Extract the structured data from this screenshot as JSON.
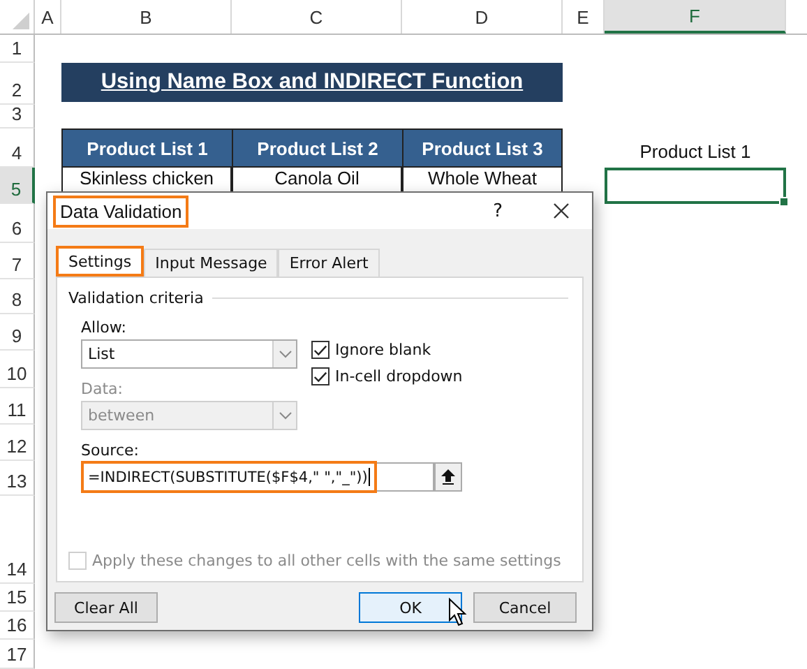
{
  "sheet": {
    "columns": [
      {
        "label": "A",
        "selected": false
      },
      {
        "label": "B",
        "selected": false
      },
      {
        "label": "C",
        "selected": false
      },
      {
        "label": "D",
        "selected": false
      },
      {
        "label": "E",
        "selected": false
      },
      {
        "label": "F",
        "selected": true
      }
    ],
    "rows": [
      {
        "label": "1",
        "selected": false
      },
      {
        "label": "2",
        "selected": false
      },
      {
        "label": "3",
        "selected": false
      },
      {
        "label": "4",
        "selected": false
      },
      {
        "label": "5",
        "selected": true
      },
      {
        "label": "6",
        "selected": false
      },
      {
        "label": "7",
        "selected": false
      },
      {
        "label": "8",
        "selected": false
      },
      {
        "label": "9",
        "selected": false
      },
      {
        "label": "10",
        "selected": false
      },
      {
        "label": "11",
        "selected": false
      },
      {
        "label": "12",
        "selected": false
      },
      {
        "label": "13",
        "selected": false
      },
      {
        "label": "14",
        "selected": false
      },
      {
        "label": "15",
        "selected": false
      },
      {
        "label": "16",
        "selected": false
      },
      {
        "label": "17",
        "selected": false
      }
    ],
    "title": "Using Name Box and INDIRECT Function",
    "table_headers": [
      "Product List 1",
      "Product List 2",
      "Product List 3"
    ],
    "table_row": [
      "Skinless chicken",
      "Canola Oil",
      "Whole Wheat"
    ],
    "f4_label": "Product List 1"
  },
  "dialog": {
    "title": "Data Validation",
    "title_highlighted": true,
    "help": "?",
    "tabs": [
      {
        "label": "Settings",
        "selected": true,
        "highlighted": true
      },
      {
        "label": "Input Message",
        "selected": false,
        "highlighted": false
      },
      {
        "label": "Error Alert",
        "selected": false,
        "highlighted": false
      }
    ],
    "section": "Validation criteria",
    "allow": {
      "label": "Allow:",
      "value": "List",
      "disabled": false
    },
    "data": {
      "label": "Data:",
      "value": "between",
      "disabled": true
    },
    "checkboxes": [
      {
        "label": "Ignore blank",
        "checked": true
      },
      {
        "label": "In-cell dropdown",
        "checked": true
      }
    ],
    "source": {
      "label": "Source:",
      "value": "=INDIRECT(SUBSTITUTE($F$4,\" \",\"_\"))",
      "highlighted": true
    },
    "apply": {
      "label": "Apply these changes to all other cells with the same settings",
      "checked": false,
      "disabled": true
    },
    "buttons": [
      {
        "label": "Clear All",
        "kind": "normal"
      },
      {
        "label": "OK",
        "kind": "default"
      },
      {
        "label": "Cancel",
        "kind": "normal"
      }
    ]
  }
}
